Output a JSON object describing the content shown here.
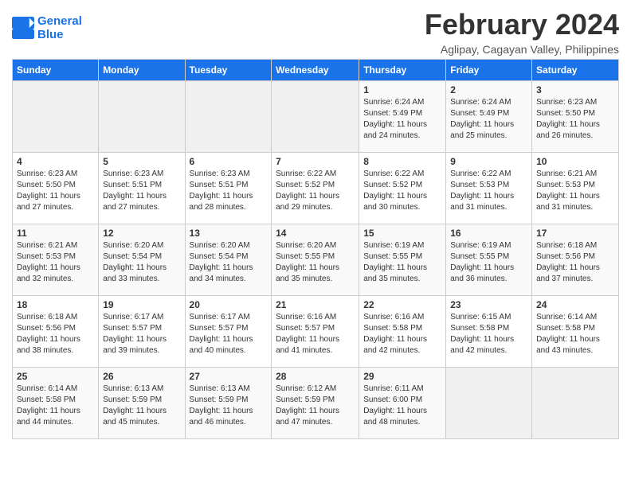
{
  "header": {
    "logo_line1": "General",
    "logo_line2": "Blue",
    "month": "February 2024",
    "location": "Aglipay, Cagayan Valley, Philippines"
  },
  "weekdays": [
    "Sunday",
    "Monday",
    "Tuesday",
    "Wednesday",
    "Thursday",
    "Friday",
    "Saturday"
  ],
  "weeks": [
    [
      {
        "day": "",
        "info": ""
      },
      {
        "day": "",
        "info": ""
      },
      {
        "day": "",
        "info": ""
      },
      {
        "day": "",
        "info": ""
      },
      {
        "day": "1",
        "info": "Sunrise: 6:24 AM\nSunset: 5:49 PM\nDaylight: 11 hours and 24 minutes."
      },
      {
        "day": "2",
        "info": "Sunrise: 6:24 AM\nSunset: 5:49 PM\nDaylight: 11 hours and 25 minutes."
      },
      {
        "day": "3",
        "info": "Sunrise: 6:23 AM\nSunset: 5:50 PM\nDaylight: 11 hours and 26 minutes."
      }
    ],
    [
      {
        "day": "4",
        "info": "Sunrise: 6:23 AM\nSunset: 5:50 PM\nDaylight: 11 hours and 27 minutes."
      },
      {
        "day": "5",
        "info": "Sunrise: 6:23 AM\nSunset: 5:51 PM\nDaylight: 11 hours and 27 minutes."
      },
      {
        "day": "6",
        "info": "Sunrise: 6:23 AM\nSunset: 5:51 PM\nDaylight: 11 hours and 28 minutes."
      },
      {
        "day": "7",
        "info": "Sunrise: 6:22 AM\nSunset: 5:52 PM\nDaylight: 11 hours and 29 minutes."
      },
      {
        "day": "8",
        "info": "Sunrise: 6:22 AM\nSunset: 5:52 PM\nDaylight: 11 hours and 30 minutes."
      },
      {
        "day": "9",
        "info": "Sunrise: 6:22 AM\nSunset: 5:53 PM\nDaylight: 11 hours and 31 minutes."
      },
      {
        "day": "10",
        "info": "Sunrise: 6:21 AM\nSunset: 5:53 PM\nDaylight: 11 hours and 31 minutes."
      }
    ],
    [
      {
        "day": "11",
        "info": "Sunrise: 6:21 AM\nSunset: 5:53 PM\nDaylight: 11 hours and 32 minutes."
      },
      {
        "day": "12",
        "info": "Sunrise: 6:20 AM\nSunset: 5:54 PM\nDaylight: 11 hours and 33 minutes."
      },
      {
        "day": "13",
        "info": "Sunrise: 6:20 AM\nSunset: 5:54 PM\nDaylight: 11 hours and 34 minutes."
      },
      {
        "day": "14",
        "info": "Sunrise: 6:20 AM\nSunset: 5:55 PM\nDaylight: 11 hours and 35 minutes."
      },
      {
        "day": "15",
        "info": "Sunrise: 6:19 AM\nSunset: 5:55 PM\nDaylight: 11 hours and 35 minutes."
      },
      {
        "day": "16",
        "info": "Sunrise: 6:19 AM\nSunset: 5:55 PM\nDaylight: 11 hours and 36 minutes."
      },
      {
        "day": "17",
        "info": "Sunrise: 6:18 AM\nSunset: 5:56 PM\nDaylight: 11 hours and 37 minutes."
      }
    ],
    [
      {
        "day": "18",
        "info": "Sunrise: 6:18 AM\nSunset: 5:56 PM\nDaylight: 11 hours and 38 minutes."
      },
      {
        "day": "19",
        "info": "Sunrise: 6:17 AM\nSunset: 5:57 PM\nDaylight: 11 hours and 39 minutes."
      },
      {
        "day": "20",
        "info": "Sunrise: 6:17 AM\nSunset: 5:57 PM\nDaylight: 11 hours and 40 minutes."
      },
      {
        "day": "21",
        "info": "Sunrise: 6:16 AM\nSunset: 5:57 PM\nDaylight: 11 hours and 41 minutes."
      },
      {
        "day": "22",
        "info": "Sunrise: 6:16 AM\nSunset: 5:58 PM\nDaylight: 11 hours and 42 minutes."
      },
      {
        "day": "23",
        "info": "Sunrise: 6:15 AM\nSunset: 5:58 PM\nDaylight: 11 hours and 42 minutes."
      },
      {
        "day": "24",
        "info": "Sunrise: 6:14 AM\nSunset: 5:58 PM\nDaylight: 11 hours and 43 minutes."
      }
    ],
    [
      {
        "day": "25",
        "info": "Sunrise: 6:14 AM\nSunset: 5:58 PM\nDaylight: 11 hours and 44 minutes."
      },
      {
        "day": "26",
        "info": "Sunrise: 6:13 AM\nSunset: 5:59 PM\nDaylight: 11 hours and 45 minutes."
      },
      {
        "day": "27",
        "info": "Sunrise: 6:13 AM\nSunset: 5:59 PM\nDaylight: 11 hours and 46 minutes."
      },
      {
        "day": "28",
        "info": "Sunrise: 6:12 AM\nSunset: 5:59 PM\nDaylight: 11 hours and 47 minutes."
      },
      {
        "day": "29",
        "info": "Sunrise: 6:11 AM\nSunset: 6:00 PM\nDaylight: 11 hours and 48 minutes."
      },
      {
        "day": "",
        "info": ""
      },
      {
        "day": "",
        "info": ""
      }
    ]
  ]
}
